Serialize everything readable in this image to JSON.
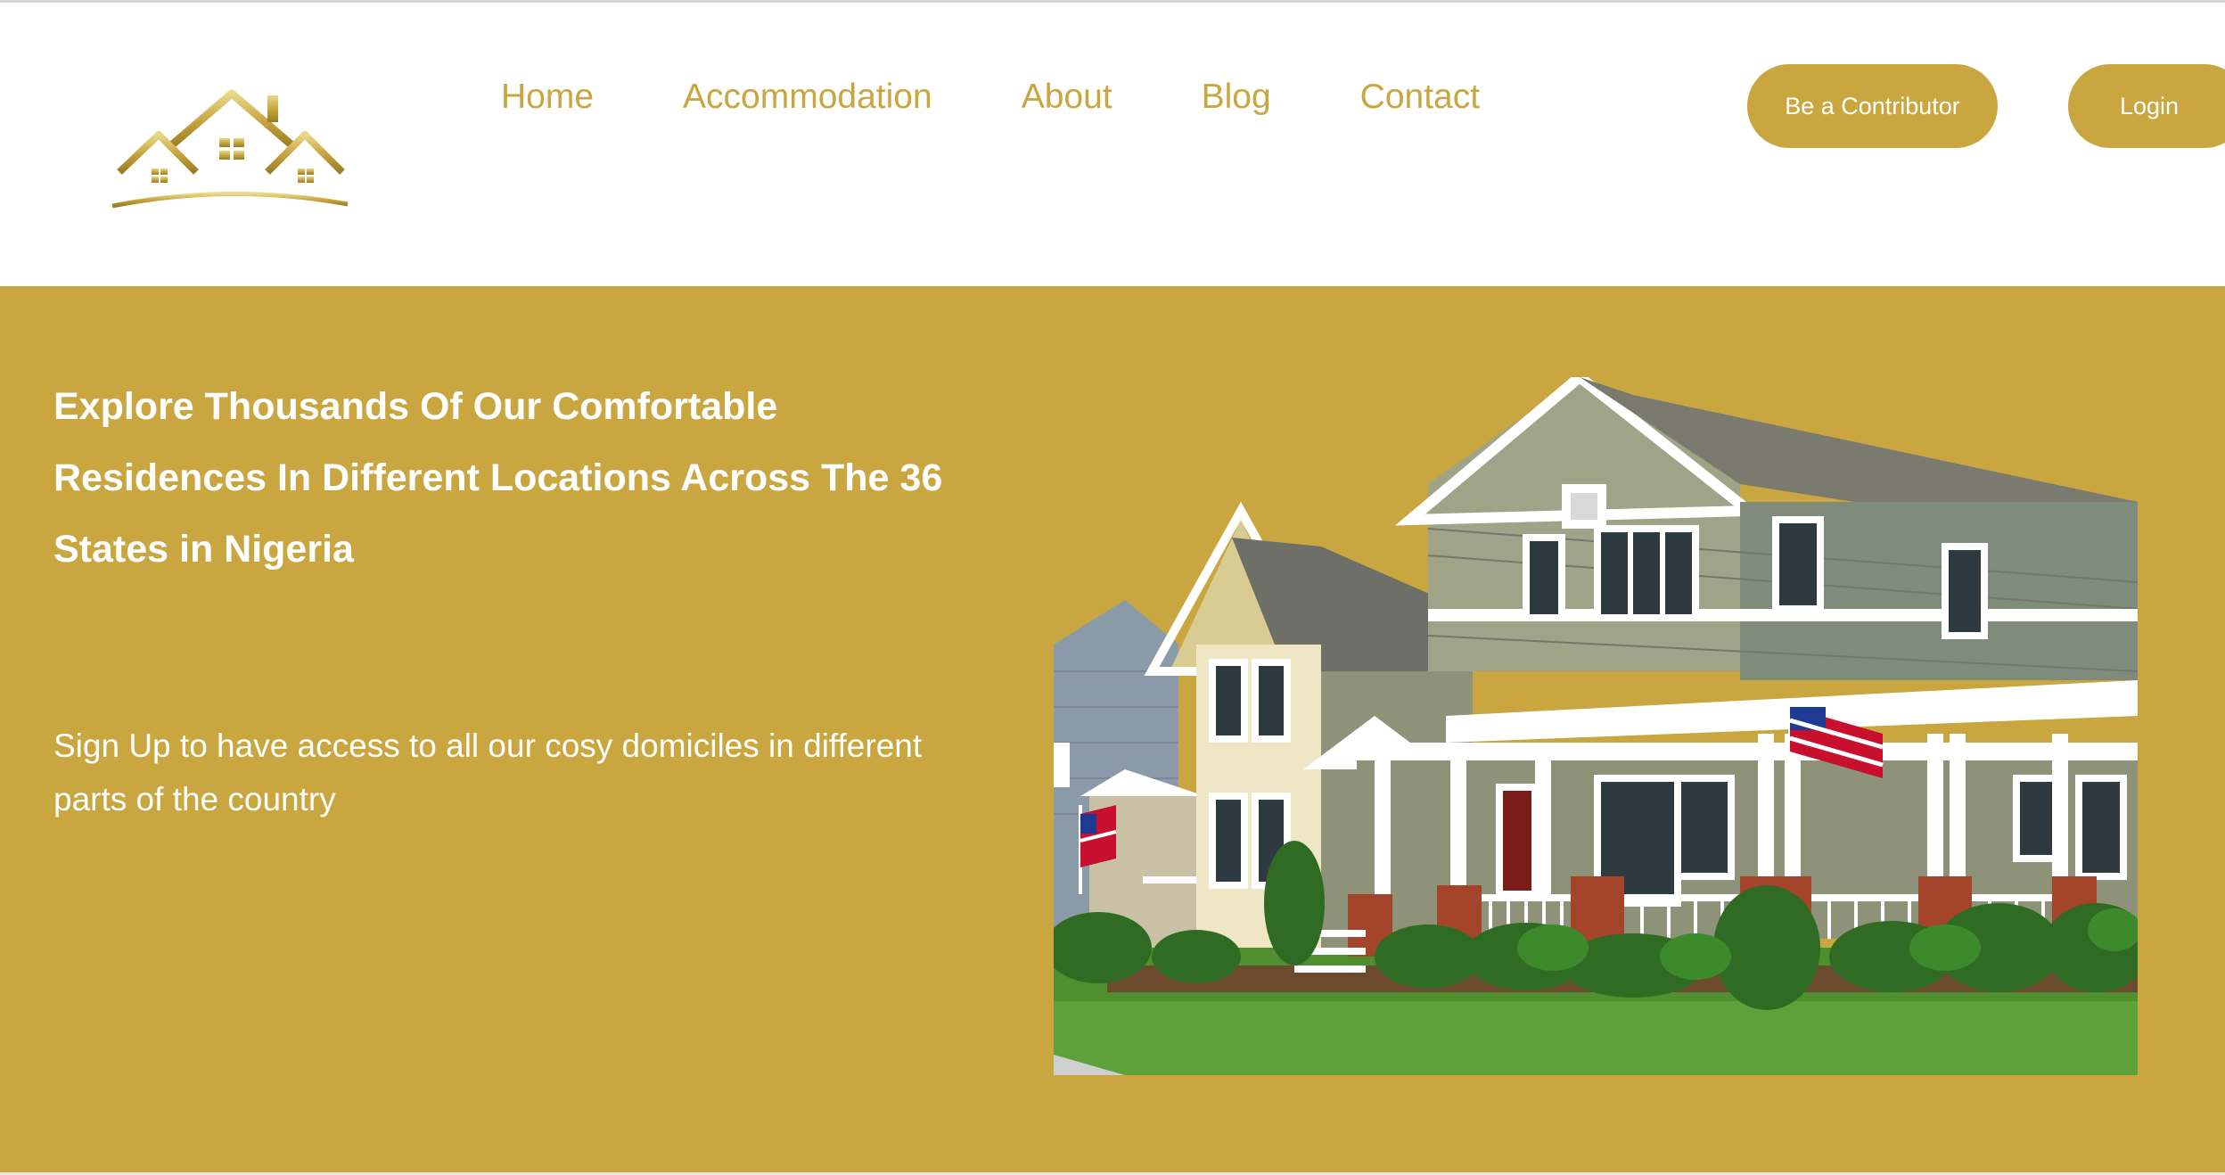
{
  "brand": {
    "logo_icon": "houses-logo-icon",
    "accent_color": "#c9a640"
  },
  "nav": {
    "items": [
      {
        "label": "Home"
      },
      {
        "label": "Accommodation"
      },
      {
        "label": "About"
      },
      {
        "label": "Blog"
      },
      {
        "label": "Contact"
      }
    ]
  },
  "header_actions": {
    "contributor_label": "Be a Contributor",
    "login_label": "Login"
  },
  "hero": {
    "title": "Explore Thousands Of Our Comfortable Residences In Different Locations Across The 36 States in Nigeria",
    "subtitle": "Sign Up to have access to all our cosy domiciles in different parts of the country",
    "image_icon": "house-photo",
    "background_color": "#c9a640"
  }
}
